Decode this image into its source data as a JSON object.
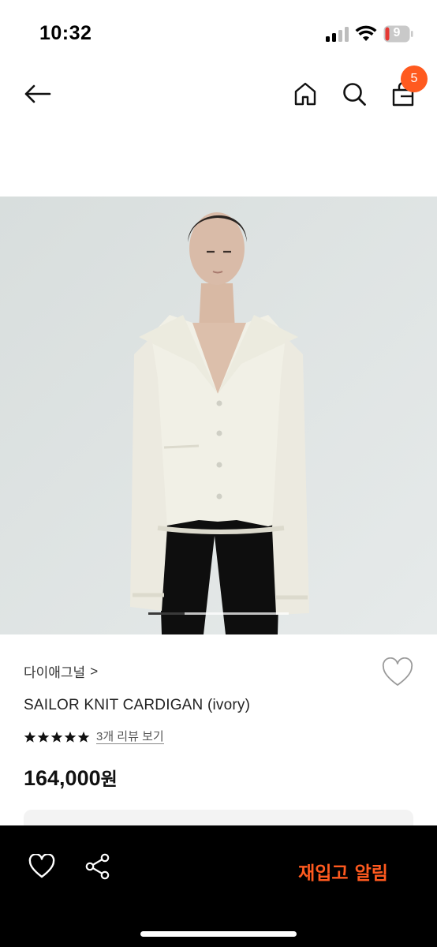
{
  "status_bar": {
    "time": "10:32",
    "battery_level": "9",
    "signal_icon": "cellular-signal-icon",
    "wifi_icon": "wifi-icon",
    "battery_icon": "battery-icon"
  },
  "top_nav": {
    "back_icon": "arrow-left-icon",
    "home_icon": "home-icon",
    "search_icon": "search-icon",
    "cart_icon": "shopping-bag-icon",
    "cart_count": "5"
  },
  "product": {
    "image_icon": "product-photo",
    "carousel_position": 1,
    "brand": "다이애그널",
    "brand_chevron": ">",
    "name": "SAILOR KNIT CARDIGAN (ivory)",
    "rating": 5,
    "review_link": "3개 리뷰 보기",
    "price_number": "164,000",
    "price_unit": "원"
  },
  "bottom_bar": {
    "wishlist_icon": "heart-icon",
    "share_icon": "share-icon",
    "restock_label": "재입고 알림"
  },
  "colors": {
    "accent": "#ff5a1f",
    "bottom_bar_bg": "#000000",
    "image_bg": "#dfe4e3"
  }
}
